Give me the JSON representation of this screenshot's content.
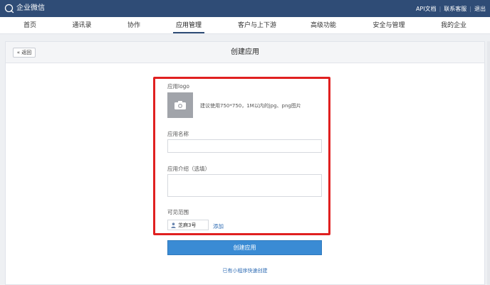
{
  "app": {
    "logo_text": "企业微信",
    "logo_icon": "chat-bubble-icon",
    "brand_color": "#2f4c76"
  },
  "toplinks": [
    "API文档",
    "联系客服",
    "退出"
  ],
  "nav": {
    "items": [
      "首页",
      "通讯录",
      "协作",
      "应用管理",
      "客户与上下游",
      "高级功能",
      "安全与管理",
      "我的企业"
    ],
    "active": "应用管理"
  },
  "page": {
    "back_label": "« 返回",
    "title": "创建应用"
  },
  "form": {
    "logo_label": "应用logo",
    "logo_icon": "camera-icon",
    "logo_hint": "建议使用750*750，1M以内的jpg、png图片",
    "name_label": "应用名称",
    "name_value": "",
    "intro_label": "应用介绍（选填）",
    "intro_value": "",
    "scope_label": "可见范围",
    "scope_icon": "person-icon",
    "scope_value": "芝麻3号",
    "add_label": "添加",
    "highlight_color": "#e02020"
  },
  "actions": {
    "create_label": "创建应用",
    "mini_program_link": "已有小程序快速创建",
    "accent_color": "#3a8bd4"
  }
}
